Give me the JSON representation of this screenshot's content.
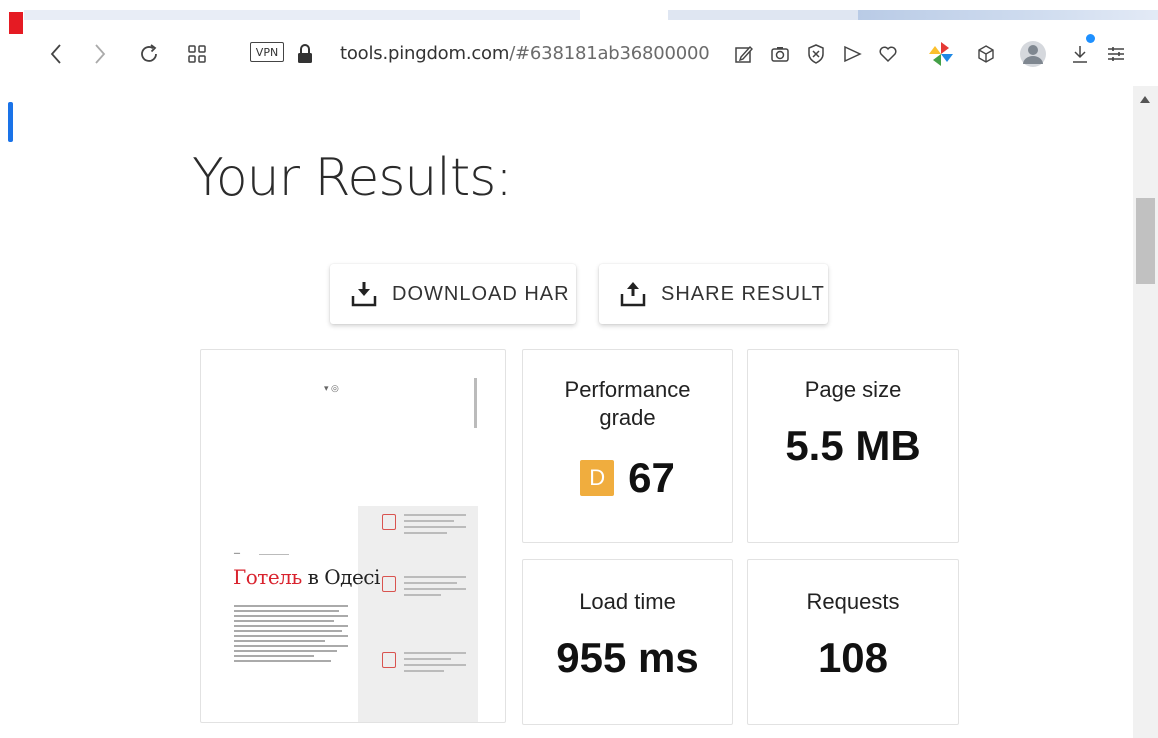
{
  "browser": {
    "url_host": "tools.pingdom.com",
    "url_rest": "/#638181ab36800000",
    "vpn_label": "VPN"
  },
  "page": {
    "title": "Your Results:",
    "buttons": {
      "download": "DOWNLOAD HAR",
      "share": "SHARE RESULT"
    },
    "metrics": {
      "performance_label": "Performance grade",
      "grade_letter": "D",
      "grade_value": "67",
      "grade_color": "#f0ad3e",
      "page_size_label": "Page size",
      "page_size_value": "5.5 MB",
      "load_time_label": "Load time",
      "load_time_value": "955 ms",
      "requests_label": "Requests",
      "requests_value": "108"
    },
    "thumbnail": {
      "heading_red": "Готель",
      "heading_rest": " в Одесі"
    }
  }
}
